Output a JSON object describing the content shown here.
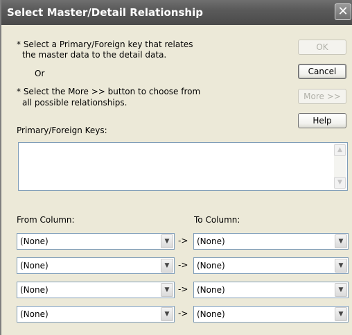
{
  "window": {
    "title": "Select Master/Detail Relationship",
    "close_glyph": "✕"
  },
  "instructions": {
    "line1": "* Select a Primary/Foreign key that relates",
    "line2": "the master data to the detail data.",
    "or": "Or",
    "line3": "* Select the More >> button to choose from",
    "line4": "all possible relationships."
  },
  "buttons": {
    "ok": "OK",
    "cancel": "Cancel",
    "more": "More >>",
    "help": "Help"
  },
  "keys_label": "Primary/Foreign Keys:",
  "columns": {
    "from_label": "From Column:",
    "to_label": "To Column:",
    "arrow": "->",
    "rows": [
      {
        "from": "(None)",
        "to": "(None)"
      },
      {
        "from": "(None)",
        "to": "(None)"
      },
      {
        "from": "(None)",
        "to": "(None)"
      },
      {
        "from": "(None)",
        "to": "(None)"
      }
    ]
  },
  "icons": {
    "dropdown": "chevron-down-icon",
    "scroll_up": "scroll-up-icon",
    "scroll_down": "scroll-down-icon",
    "close": "close-icon"
  },
  "colors": {
    "dialog_bg": "#ece9d8",
    "titlebar": "#5a5a5a",
    "field_border": "#7f9db9"
  }
}
